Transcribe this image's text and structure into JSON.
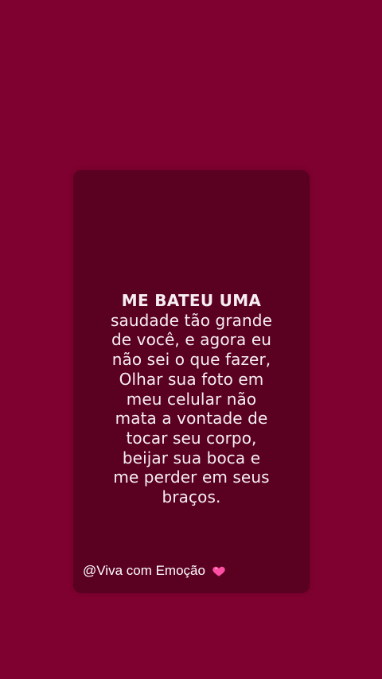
{
  "background_color": "#7f012f",
  "card_color": "#5a0021",
  "quote": {
    "lines": [
      "ME BATEU UMA",
      "saudade tão grande",
      "de você, e agora eu",
      "não sei o que fazer,",
      "Olhar sua foto em",
      "meu celular não",
      "mata a vontade de",
      "tocar seu corpo,",
      "beijar sua boca e",
      "me perder em seus",
      "braços."
    ]
  },
  "footer": {
    "handle": "@Viva com Emoção",
    "icon": "pink-heart-icon",
    "icon_color": "#ff4fa3"
  }
}
